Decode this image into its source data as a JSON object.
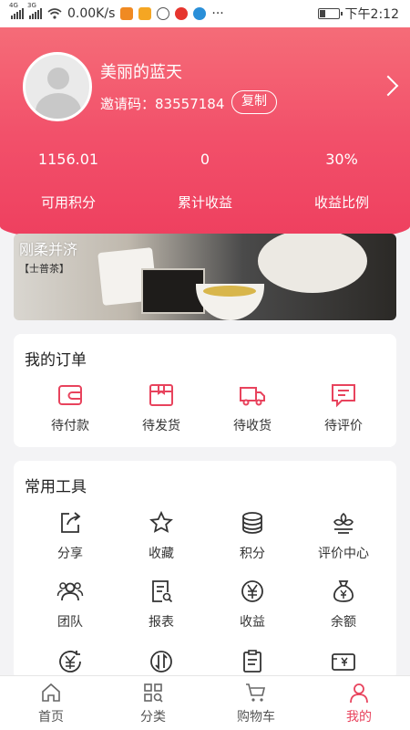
{
  "status_bar": {
    "net_left": "4G",
    "net_right": "3G",
    "speed": "0.00K/s",
    "more": "···",
    "time": "下午2:12"
  },
  "profile": {
    "username": "美丽的蓝天",
    "invite_label": "邀请码：",
    "invite_code": "83557184",
    "copy_label": "复制"
  },
  "stats": [
    {
      "value": "1156.01",
      "label": "可用积分"
    },
    {
      "value": "0",
      "label": "累计收益"
    },
    {
      "value": "30%",
      "label": "收益比例"
    }
  ],
  "banner": {
    "title": "刚柔并济",
    "subtitle": "【士普茶】"
  },
  "orders": {
    "title": "我的订单",
    "items": [
      {
        "label": "待付款",
        "icon": "wallet-icon"
      },
      {
        "label": "待发货",
        "icon": "package-icon"
      },
      {
        "label": "待收货",
        "icon": "truck-icon"
      },
      {
        "label": "待评价",
        "icon": "comment-icon"
      }
    ]
  },
  "tools": {
    "title": "常用工具",
    "items": [
      {
        "label": "分享",
        "icon": "share-icon"
      },
      {
        "label": "收藏",
        "icon": "star-icon"
      },
      {
        "label": "积分",
        "icon": "coins-icon"
      },
      {
        "label": "评价中心",
        "icon": "flower-icon"
      },
      {
        "label": "团队",
        "icon": "team-icon"
      },
      {
        "label": "报表",
        "icon": "report-icon"
      },
      {
        "label": "收益",
        "icon": "yuan-circle-icon"
      },
      {
        "label": "余额",
        "icon": "money-bag-icon"
      },
      {
        "label": "",
        "icon": "yuan-refresh-icon"
      },
      {
        "label": "",
        "icon": "exchange-icon"
      },
      {
        "label": "",
        "icon": "clipboard-icon"
      },
      {
        "label": "",
        "icon": "yuan-card-icon"
      }
    ]
  },
  "nav": [
    {
      "label": "首页",
      "icon": "home-icon"
    },
    {
      "label": "分类",
      "icon": "category-icon"
    },
    {
      "label": "购物车",
      "icon": "cart-icon"
    },
    {
      "label": "我的",
      "icon": "user-icon"
    }
  ],
  "colors": {
    "accent": "#e8435d",
    "hero_top": "#f56c78",
    "hero_bottom": "#ee3e5e"
  }
}
